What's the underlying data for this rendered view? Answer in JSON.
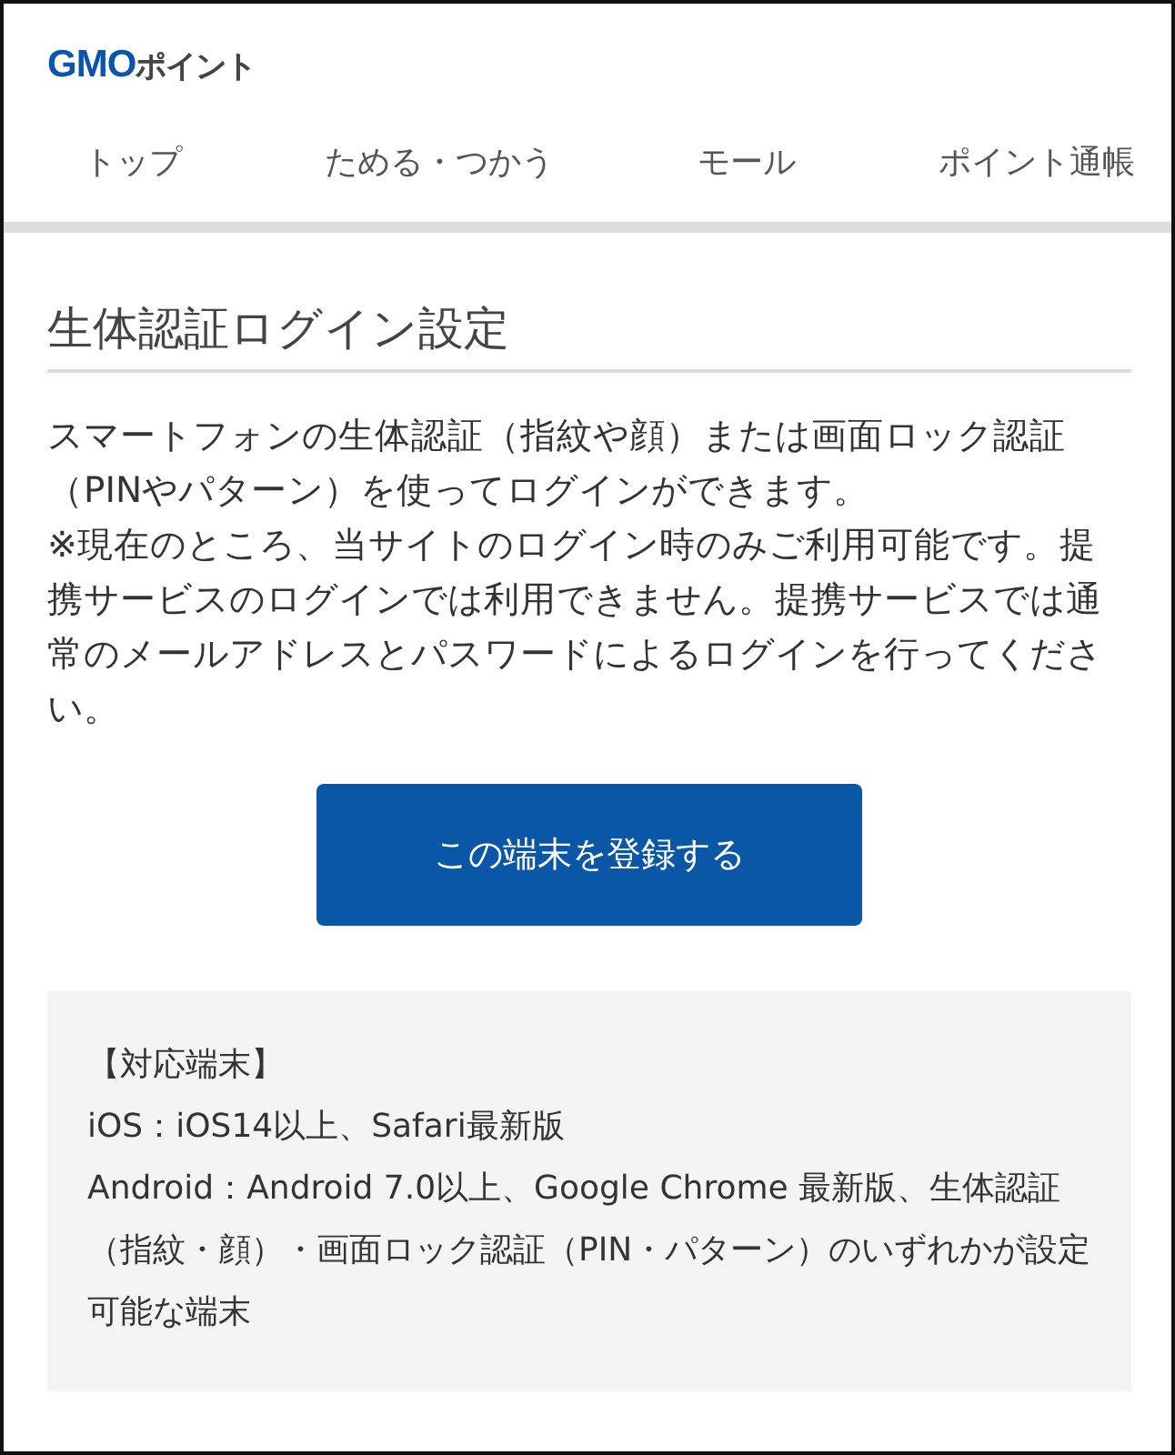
{
  "logo": {
    "brand": "GMO",
    "service": "ポイント"
  },
  "nav": [
    {
      "label": "トップ",
      "selected": false
    },
    {
      "label": "ためる・つかう",
      "selected": false
    },
    {
      "label": "モール",
      "selected": false
    },
    {
      "label": "ポイント通帳",
      "selected": false
    }
  ],
  "page_title": "生体認証ログイン設定",
  "description": "スマートフォンの生体認証（指紋や顔）または画面ロック認証（PINやパターン）を使ってログインができます。\n※現在のところ、当サイトのログイン時のみご利用可能です。提携サービスのログインでは利用できません。提携サービスでは通常のメールアドレスとパスワードによるログインを行ってください。",
  "register_button": "この端末を登録する",
  "supported_devices": {
    "heading": "【対応端末】",
    "lines": [
      "iOS：iOS14以上、Safari最新版",
      "Android：Android 7.0以上、Google Chrome 最新版、生体認証（指紋・顔）・画面ロック認証（PIN・パターン）のいずれかが設定可能な端末"
    ]
  }
}
